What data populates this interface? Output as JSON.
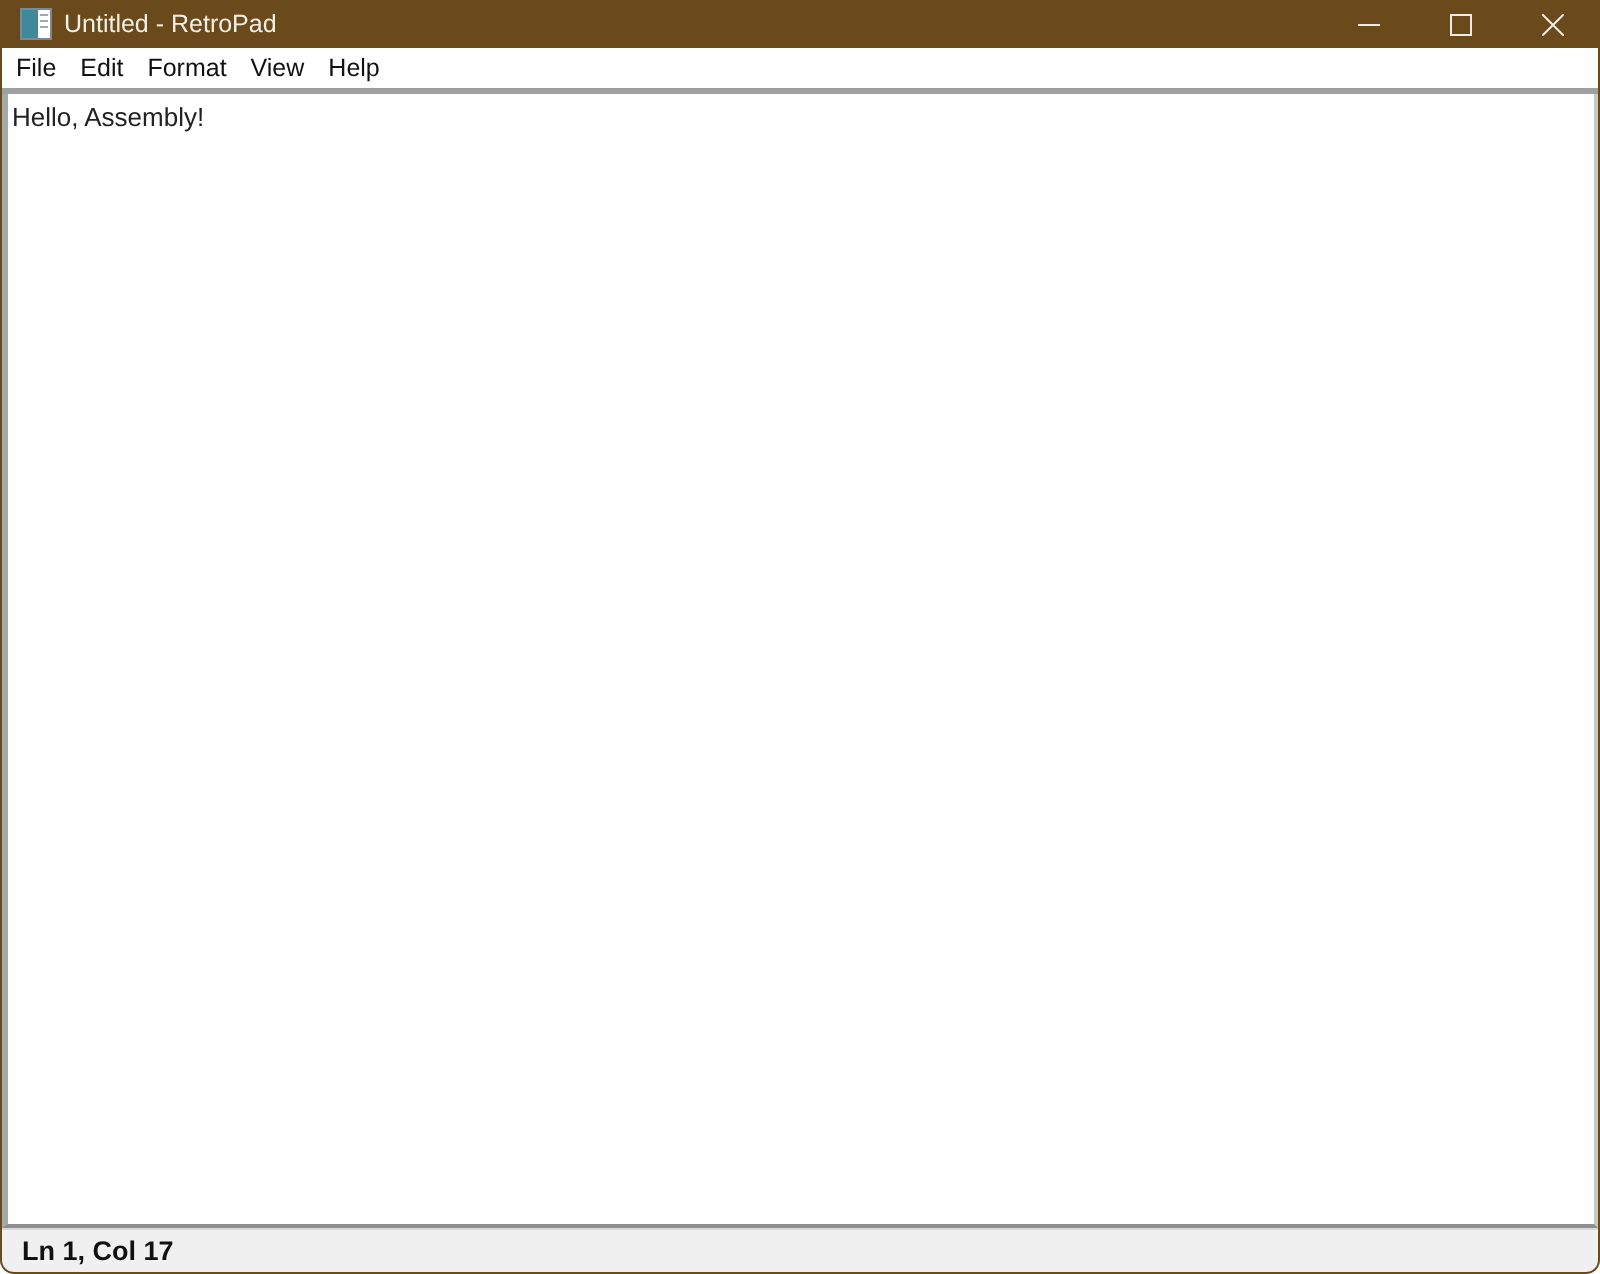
{
  "window": {
    "title": "Untitled - RetroPad"
  },
  "menu": [
    "File",
    "Edit",
    "Format",
    "View",
    "Help"
  ],
  "editor": {
    "value": "Hello, Assembly!"
  },
  "status_bar": {
    "text": "Ln 1, Col 17"
  }
}
